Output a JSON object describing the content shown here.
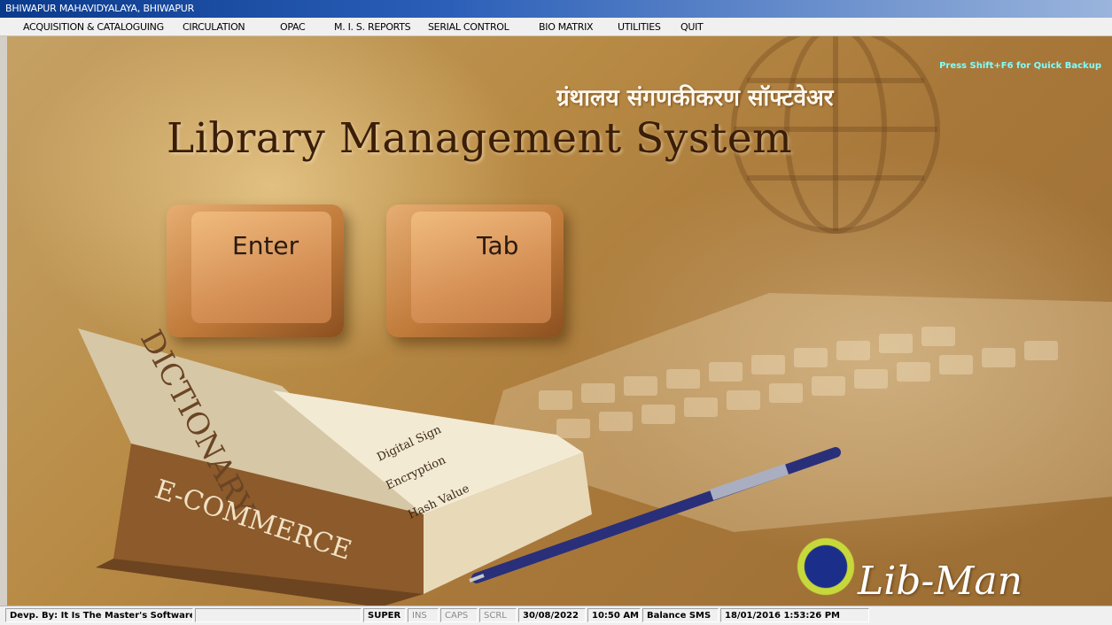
{
  "window": {
    "title": "BHIWAPUR MAHAVIDYALAYA, BHIWAPUR"
  },
  "menu": [
    "ACQUISITION & CATALOGUING",
    "CIRCULATION",
    "OPAC",
    "M. I. S. REPORTS",
    "SERIAL CONTROL",
    "BIO MATRIX",
    "UTILITIES",
    "QUIT"
  ],
  "splash": {
    "quick_backup_hint": "Press Shift+F6 for Quick Backup",
    "hindi_title": "ग्रंथालय संगणकीकरण सॉफ्टवेअर",
    "title": "Library Management System",
    "key_enter": "Enter",
    "key_tab": "Tab",
    "book_spine": "E-COMMERCE",
    "book_cover": "DICTIONARY",
    "book_entries": [
      "Encryption",
      "Digital Sign",
      "Hash Value"
    ],
    "logo_text": "Lib-Man"
  },
  "status": {
    "developer": "Devp. By: It Is The Master's Software",
    "blank": "",
    "user": "SUPER",
    "ins": "INS",
    "caps": "CAPS",
    "scrl": "SCRL",
    "date": "30/08/2022",
    "time": "10:50 AM",
    "balance": "Balance SMS",
    "timestamp": "18/01/2016 1:53:26 PM"
  },
  "colors": {
    "title_bar": "#0a3a8c",
    "accent_cyan": "#80ffff",
    "background": "#b88b45"
  }
}
